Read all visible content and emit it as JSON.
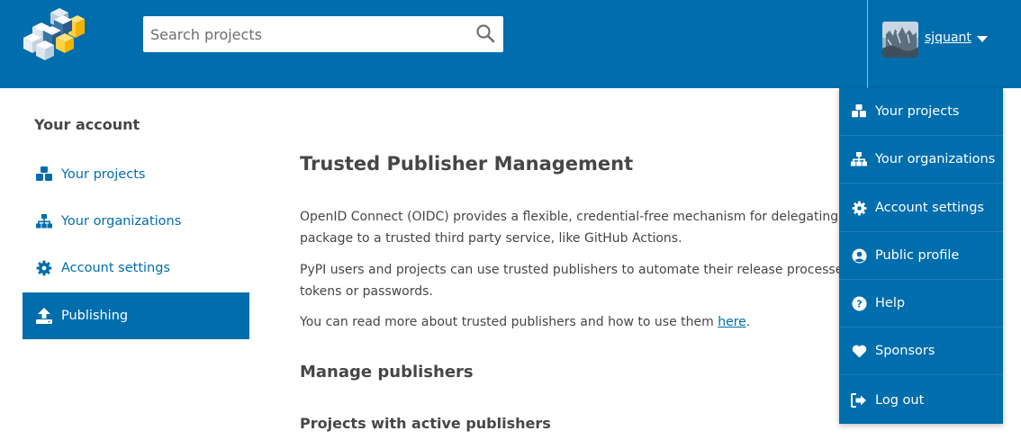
{
  "search": {
    "placeholder": "Search projects",
    "icon": "search-icon"
  },
  "user": {
    "name": "sjquant"
  },
  "sidebar": {
    "heading": "Your account",
    "items": [
      {
        "label": "Your projects",
        "icon": "cubes-icon"
      },
      {
        "label": "Your organizations",
        "icon": "sitemap-icon"
      },
      {
        "label": "Account settings",
        "icon": "gear-icon"
      },
      {
        "label": "Publishing",
        "icon": "upload-icon",
        "active": true
      }
    ]
  },
  "main": {
    "title": "Trusted Publisher Management",
    "para1_line1": "OpenID Connect (OIDC) provides a flexible, credential-free mechanism for delegating publi",
    "para1_line2": "package to a trusted third party service, like GitHub Actions.",
    "para2_line1": "PyPI users and projects can use trusted publishers to automate their release processes, wit",
    "para2_line2": "tokens or passwords.",
    "para3_text": "You can read more about trusted publishers and how to use them ",
    "para3_link": "here",
    "para3_end": ".",
    "manage_heading": "Manage publishers",
    "projects_heading": "Projects with active publishers"
  },
  "dropdown": {
    "items": [
      {
        "label": "Your projects",
        "icon": "cubes-icon"
      },
      {
        "label": "Your organizations",
        "icon": "sitemap-icon"
      },
      {
        "label": "Account settings",
        "icon": "gear-icon"
      },
      {
        "label": "Public profile",
        "icon": "user-circle-icon"
      },
      {
        "label": "Help",
        "icon": "question-circle-icon"
      },
      {
        "label": "Sponsors",
        "icon": "heart-icon"
      },
      {
        "label": "Log out",
        "icon": "sign-out-icon"
      }
    ]
  },
  "colors": {
    "brand": "#006dad",
    "text": "#464646",
    "logo_yellow": "#ffd242"
  }
}
